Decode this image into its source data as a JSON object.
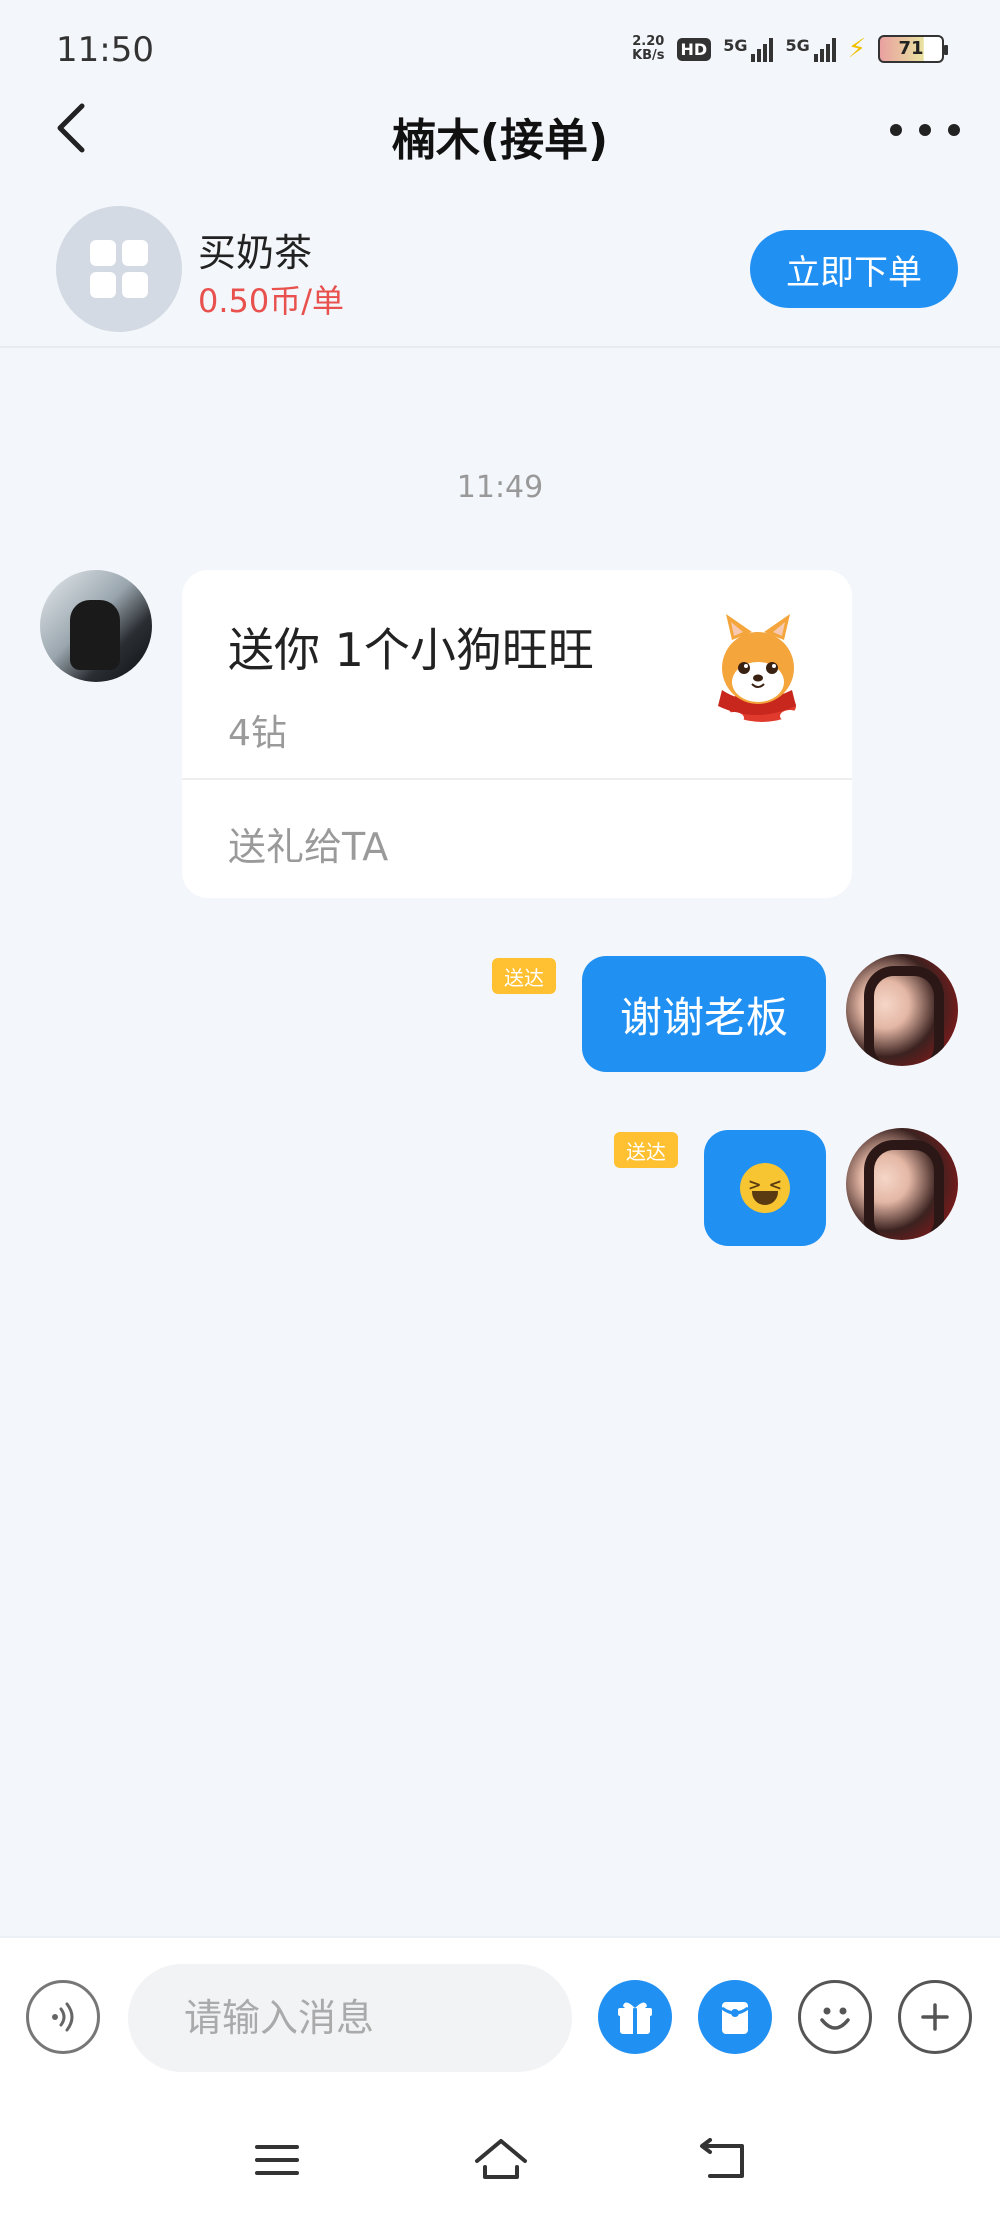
{
  "status_bar": {
    "time": "11:50",
    "net_speed_value": "2.20",
    "net_speed_unit": "KB/s",
    "hd_label": "HD",
    "signal1_label": "5G",
    "signal2_label": "5G",
    "battery": "71"
  },
  "header": {
    "title": "楠木(接单)"
  },
  "service": {
    "name": "买奶茶",
    "price": "0.50币/单",
    "order_button": "立即下单"
  },
  "chat": {
    "timestamp": "11:49",
    "gift_card": {
      "title": "送你 1个小狗旺旺",
      "price": "4钻",
      "action": "送礼给TA"
    },
    "messages": [
      {
        "status": "送达",
        "text": "谢谢老板"
      },
      {
        "status": "送达",
        "emoji": "grinning-squinting-face"
      }
    ]
  },
  "input": {
    "placeholder": "请输入消息"
  },
  "colors": {
    "accent": "#2190f3",
    "price_red": "#e8514d",
    "delivered_badge": "#ffc031"
  }
}
